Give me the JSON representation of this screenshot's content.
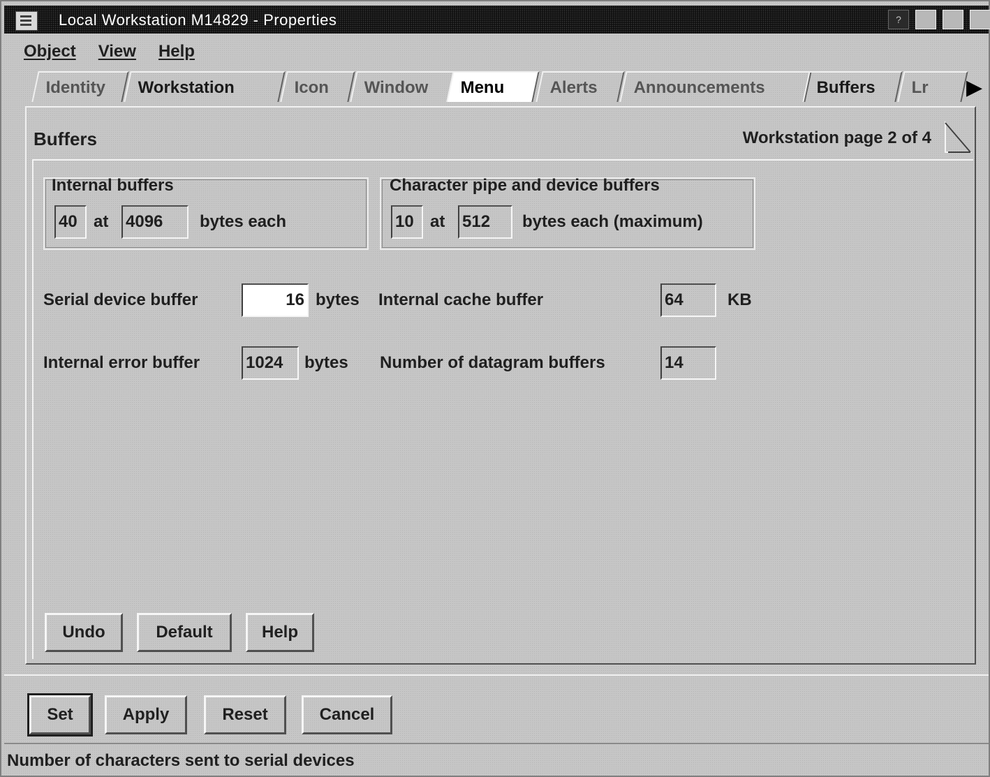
{
  "window": {
    "title": "Local Workstation M14829 - Properties",
    "help_glyph": "?"
  },
  "menubar": {
    "items": [
      "Object",
      "View",
      "Help"
    ]
  },
  "tabs": {
    "items": [
      "Identity",
      "Workstation",
      "Icon",
      "Window",
      "Menu",
      "Alerts",
      "Announcements",
      "Buffers",
      "Lr"
    ],
    "scroll_arrow": "▶"
  },
  "page": {
    "title": "Buffers",
    "page_info": "Workstation page 2 of 4"
  },
  "internal_buffers": {
    "label": "Internal buffers",
    "count": "40",
    "at": "at",
    "size": "4096",
    "suffix": "bytes each"
  },
  "char_pipe_buffers": {
    "label": "Character pipe and device buffers",
    "count": "10",
    "at": "at",
    "size": "512",
    "suffix": "bytes each (maximum)"
  },
  "serial_device_buffer": {
    "label": "Serial device buffer",
    "value": "16",
    "unit": "bytes"
  },
  "internal_cache_buffer": {
    "label": "Internal cache buffer",
    "value": "64",
    "unit": "KB"
  },
  "internal_error_buffer": {
    "label": "Internal error buffer",
    "value": "1024",
    "unit": "bytes"
  },
  "datagram_buffers": {
    "label": "Number of datagram buffers",
    "value": "14"
  },
  "page_buttons": {
    "undo": "Undo",
    "default": "Default",
    "help": "Help"
  },
  "dialog_buttons": {
    "set": "Set",
    "apply": "Apply",
    "reset": "Reset",
    "cancel": "Cancel"
  },
  "status_bar": {
    "text": "Number of characters sent to serial devices"
  }
}
